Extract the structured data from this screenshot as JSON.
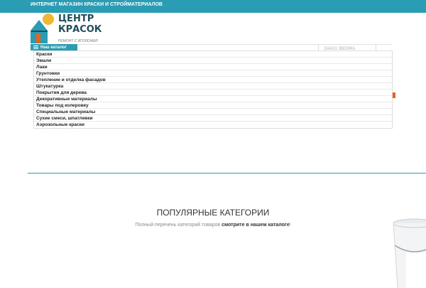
{
  "top_bar": {
    "text": "ИНТЕРНЕТ МАГАЗИН КРАСКИ И СТРОЙМАТЕРИАЛОВ"
  },
  "logo": {
    "line1": "ЦЕНТР",
    "line2": "КРАСОК",
    "tagline": "РЕМОНТ С ИГОЛОЧКИ!"
  },
  "catalog_button": {
    "label": "Наш каталог"
  },
  "header_hidden_text": "ЗАКАЗ ЗВОНКА",
  "menu": {
    "items": [
      "Краски",
      "Эмали",
      "Лаки",
      "Грунтовки",
      "Утепление и отделка фасадов",
      "Штукатурка",
      "Покрытия для дерева",
      "Декоративные материалы",
      "Товары под колеровку",
      "Специальные материалы",
      "Сухие смеси, шпатлевки",
      "Аэрозольные краски"
    ]
  },
  "popular": {
    "title": "ПОПУЛЯРНЫЕ КАТЕГОРИИ",
    "subtitle_plain": "Полный перечень категорий товаров ",
    "subtitle_bold": "смотрите в нашем каталоге",
    "subtitle_end": "!"
  },
  "colors": {
    "accent": "#2a9cb3",
    "orange": "#e8621d",
    "logo_yellow": "#f2b632",
    "logo_dark": "#1f4f5c"
  }
}
